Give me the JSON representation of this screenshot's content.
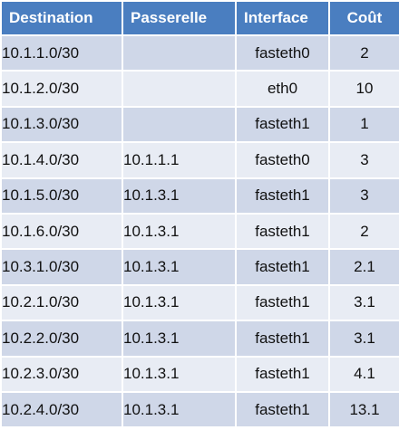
{
  "headers": {
    "destination": "Destination",
    "gateway": "Passerelle",
    "interface": "Interface",
    "cost": "Coût"
  },
  "rows": [
    {
      "destination": "10.1.1.0/30",
      "gateway": "",
      "interface": "fasteth0",
      "cost": "2"
    },
    {
      "destination": "10.1.2.0/30",
      "gateway": "",
      "interface": "eth0",
      "cost": "10"
    },
    {
      "destination": "10.1.3.0/30",
      "gateway": "",
      "interface": "fasteth1",
      "cost": "1"
    },
    {
      "destination": "10.1.4.0/30",
      "gateway": "10.1.1.1",
      "interface": "fasteth0",
      "cost": "3"
    },
    {
      "destination": "10.1.5.0/30",
      "gateway": "10.1.3.1",
      "interface": "fasteth1",
      "cost": "3"
    },
    {
      "destination": "10.1.6.0/30",
      "gateway": "10.1.3.1",
      "interface": "fasteth1",
      "cost": "2"
    },
    {
      "destination": "10.3.1.0/30",
      "gateway": "10.1.3.1",
      "interface": "fasteth1",
      "cost": "2.1"
    },
    {
      "destination": "10.2.1.0/30",
      "gateway": "10.1.3.1",
      "interface": "fasteth1",
      "cost": "3.1"
    },
    {
      "destination": "10.2.2.0/30",
      "gateway": "10.1.3.1",
      "interface": "fasteth1",
      "cost": "3.1"
    },
    {
      "destination": "10.2.3.0/30",
      "gateway": "10.1.3.1",
      "interface": "fasteth1",
      "cost": "4.1"
    },
    {
      "destination": "10.2.4.0/30",
      "gateway": "10.1.3.1",
      "interface": "fasteth1",
      "cost": "13.1"
    }
  ],
  "colors": {
    "header_bg": "#4a7ec0",
    "row_odd_bg": "#cfd7e8",
    "row_even_bg": "#e8ecf4"
  }
}
